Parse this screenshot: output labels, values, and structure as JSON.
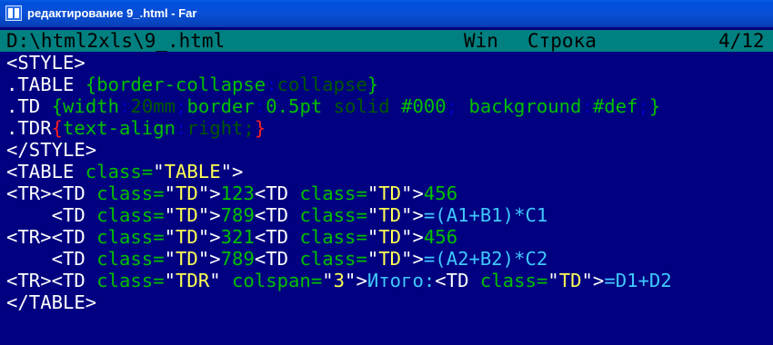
{
  "window": {
    "title": "редактирование 9_.html - Far",
    "icon": "far-manager-icon"
  },
  "status": {
    "file_path": "D:\\html2xls\\9_.html",
    "encoding": "Win",
    "line_label": "Строка",
    "position": "4/12"
  },
  "editor": {
    "lines": [
      [
        {
          "t": "<STYLE>",
          "c": "w"
        }
      ],
      [
        {
          "t": ".TABLE ",
          "c": "w"
        },
        {
          "t": "{",
          "c": "g"
        },
        {
          "t": "border-collapse",
          "c": "g"
        },
        {
          "t": ":",
          "c": "b"
        },
        {
          "t": "collapse",
          "c": "dg"
        },
        {
          "t": "}",
          "c": "g"
        }
      ],
      [
        {
          "t": ".TD ",
          "c": "w"
        },
        {
          "t": "{",
          "c": "g"
        },
        {
          "t": "width",
          "c": "g"
        },
        {
          "t": ":",
          "c": "b"
        },
        {
          "t": "20mm",
          "c": "dg"
        },
        {
          "t": ";",
          "c": "b"
        },
        {
          "t": "border",
          "c": "g"
        },
        {
          "t": ":",
          "c": "b"
        },
        {
          "t": "0.5pt ",
          "c": "g"
        },
        {
          "t": "solid",
          "c": "dg"
        },
        {
          "t": " #000",
          "c": "g"
        },
        {
          "t": ";",
          "c": "b"
        },
        {
          "t": " background",
          "c": "g"
        },
        {
          "t": ":",
          "c": "b"
        },
        {
          "t": "#def",
          "c": "g"
        },
        {
          "t": ";",
          "c": "b"
        },
        {
          "t": "}",
          "c": "g"
        }
      ],
      [
        {
          "t": ".TDR",
          "c": "w"
        },
        {
          "t": "{",
          "c": "r"
        },
        {
          "t": "text-align",
          "c": "g"
        },
        {
          "t": ":",
          "c": "b"
        },
        {
          "t": "right",
          "c": "dg"
        },
        {
          "t": ";",
          "c": "dg"
        },
        {
          "t": "}",
          "c": "r"
        }
      ],
      [
        {
          "t": "</STYLE>",
          "c": "w"
        }
      ],
      [
        {
          "t": "<TABLE ",
          "c": "w"
        },
        {
          "t": "class=",
          "c": "g"
        },
        {
          "t": "\"",
          "c": "w"
        },
        {
          "t": "TABLE",
          "c": "y"
        },
        {
          "t": "\">",
          "c": "w"
        }
      ],
      [
        {
          "t": "<TR><TD ",
          "c": "w"
        },
        {
          "t": "class=",
          "c": "g"
        },
        {
          "t": "\"",
          "c": "w"
        },
        {
          "t": "TD",
          "c": "y"
        },
        {
          "t": "\">",
          "c": "w"
        },
        {
          "t": "123",
          "c": "g"
        },
        {
          "t": "<TD ",
          "c": "w"
        },
        {
          "t": "class=",
          "c": "g"
        },
        {
          "t": "\"",
          "c": "w"
        },
        {
          "t": "TD",
          "c": "y"
        },
        {
          "t": "\">",
          "c": "w"
        },
        {
          "t": "456",
          "c": "g"
        }
      ],
      [
        {
          "t": "    <TD ",
          "c": "w"
        },
        {
          "t": "class=",
          "c": "g"
        },
        {
          "t": "\"",
          "c": "w"
        },
        {
          "t": "TD",
          "c": "y"
        },
        {
          "t": "\">",
          "c": "w"
        },
        {
          "t": "789",
          "c": "g"
        },
        {
          "t": "<TD ",
          "c": "w"
        },
        {
          "t": "class=",
          "c": "g"
        },
        {
          "t": "\"",
          "c": "w"
        },
        {
          "t": "TD",
          "c": "y"
        },
        {
          "t": "\">",
          "c": "w"
        },
        {
          "t": "=(A1+B1)*C1",
          "c": "c"
        }
      ],
      [
        {
          "t": "<TR><TD ",
          "c": "w"
        },
        {
          "t": "class=",
          "c": "g"
        },
        {
          "t": "\"",
          "c": "w"
        },
        {
          "t": "TD",
          "c": "y"
        },
        {
          "t": "\">",
          "c": "w"
        },
        {
          "t": "321",
          "c": "g"
        },
        {
          "t": "<TD ",
          "c": "w"
        },
        {
          "t": "class=",
          "c": "g"
        },
        {
          "t": "\"",
          "c": "w"
        },
        {
          "t": "TD",
          "c": "y"
        },
        {
          "t": "\">",
          "c": "w"
        },
        {
          "t": "456",
          "c": "g"
        }
      ],
      [
        {
          "t": "    <TD ",
          "c": "w"
        },
        {
          "t": "class=",
          "c": "g"
        },
        {
          "t": "\"",
          "c": "w"
        },
        {
          "t": "TD",
          "c": "y"
        },
        {
          "t": "\">",
          "c": "w"
        },
        {
          "t": "789",
          "c": "g"
        },
        {
          "t": "<TD ",
          "c": "w"
        },
        {
          "t": "class=",
          "c": "g"
        },
        {
          "t": "\"",
          "c": "w"
        },
        {
          "t": "TD",
          "c": "y"
        },
        {
          "t": "\">",
          "c": "w"
        },
        {
          "t": "=(A2+B2)*C2",
          "c": "c"
        }
      ],
      [
        {
          "t": "<TR><TD ",
          "c": "w"
        },
        {
          "t": "class=",
          "c": "g"
        },
        {
          "t": "\"",
          "c": "w"
        },
        {
          "t": "TDR",
          "c": "y"
        },
        {
          "t": "\" ",
          "c": "w"
        },
        {
          "t": "colspan=",
          "c": "g"
        },
        {
          "t": "\"",
          "c": "w"
        },
        {
          "t": "3",
          "c": "y"
        },
        {
          "t": "\">",
          "c": "w"
        },
        {
          "t": "Итого:",
          "c": "c"
        },
        {
          "t": "<TD ",
          "c": "w"
        },
        {
          "t": "class=",
          "c": "g"
        },
        {
          "t": "\"",
          "c": "w"
        },
        {
          "t": "TD",
          "c": "y"
        },
        {
          "t": "\">",
          "c": "w"
        },
        {
          "t": "=D1+D2",
          "c": "c"
        }
      ],
      [
        {
          "t": "</TABLE>",
          "c": "w"
        }
      ]
    ]
  },
  "colors": {
    "editor_background": "#000080",
    "statusbar_background": "#008080",
    "titlebar_blue": "#0a4fd6",
    "tag_white": "#ffffff",
    "attr_green": "#00c000",
    "string_yellow": "#ffff55",
    "formula_cyan": "#40c8ff",
    "brace_red": "#ff2020"
  }
}
